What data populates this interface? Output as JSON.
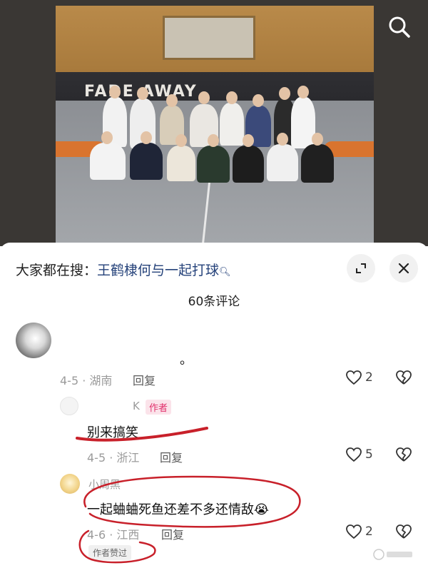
{
  "photo": {
    "wall_text": "FADE AWAY",
    "alt": ""
  },
  "search_icon": "search-icon",
  "sheet": {
    "search_prefix": "大家都在搜：",
    "search_keyword": "王鹤棣何与一起打球",
    "comment_count": "60条评论",
    "minimize_icon": "minimize-icon",
    "close_icon": "close-icon"
  },
  "comments": [
    {
      "text": "。",
      "meta": "4-5 · 湖南",
      "reply_label": "回复",
      "likes": "2"
    },
    {
      "username": "K",
      "author_tag": "作者",
      "text": "别来搞笑",
      "meta": "4-5 · 浙江",
      "reply_label": "回复",
      "likes": "5"
    },
    {
      "username": "小周黑",
      "text": "一起蛐蛐死鱼还差不多还情敌😭",
      "meta": "4-6 · 江西",
      "reply_label": "回复",
      "likes": "2",
      "liked_tag": "作者赞过"
    }
  ],
  "colors": {
    "accent_link": "#25427a",
    "author_tag": "#e1306c",
    "annotation_red": "#c8202a"
  }
}
